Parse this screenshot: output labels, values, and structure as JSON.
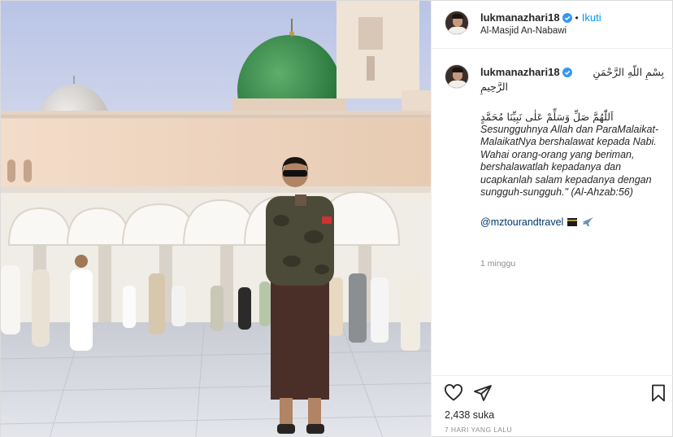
{
  "post": {
    "username": "lukmanazhari18",
    "follow_label": "Ikuti",
    "separator": "•",
    "location": "Al-Masjid An-Nabawi",
    "photo_alt": "Man standing in front of Masjid An-Nabawi"
  },
  "caption": {
    "username": "lukmanazhari18",
    "arabic_line1": "بِسْمِ اللّهِ الرَّحْمَنِ",
    "arabic_line2": "الرَّحِيمِ",
    "arabic_line3": "اَللّٰهُمَّ صَلِّ وَسَلِّمْ عَلٰى نَبِيِّنَا مُحَمَّدٍ",
    "text": "Sesungguhnya Allah dan ParaMalaikat-MalaikatNya bershalawat kepada Nabi. Wahai orang-orang yang beriman, bershalawatlah kepadanya dan ucapkanlah salam kepadanya dengan sungguh-sungguh.\" (Al-Ahzab:56)",
    "mention": "@mztourandtravel",
    "time_ago": "1 minggu"
  },
  "actions": {
    "likes": "2,438 suka",
    "date": "7 HARI YANG LALU"
  },
  "colors": {
    "link_blue": "#0095f6",
    "mention_blue": "#00376b",
    "muted_gray": "#8e8e8e",
    "border": "#dbdbdb"
  },
  "icons": [
    "verified-badge-icon",
    "heart-icon",
    "share-icon",
    "bookmark-icon",
    "kaaba-emoji-icon",
    "airplane-emoji-icon"
  ]
}
